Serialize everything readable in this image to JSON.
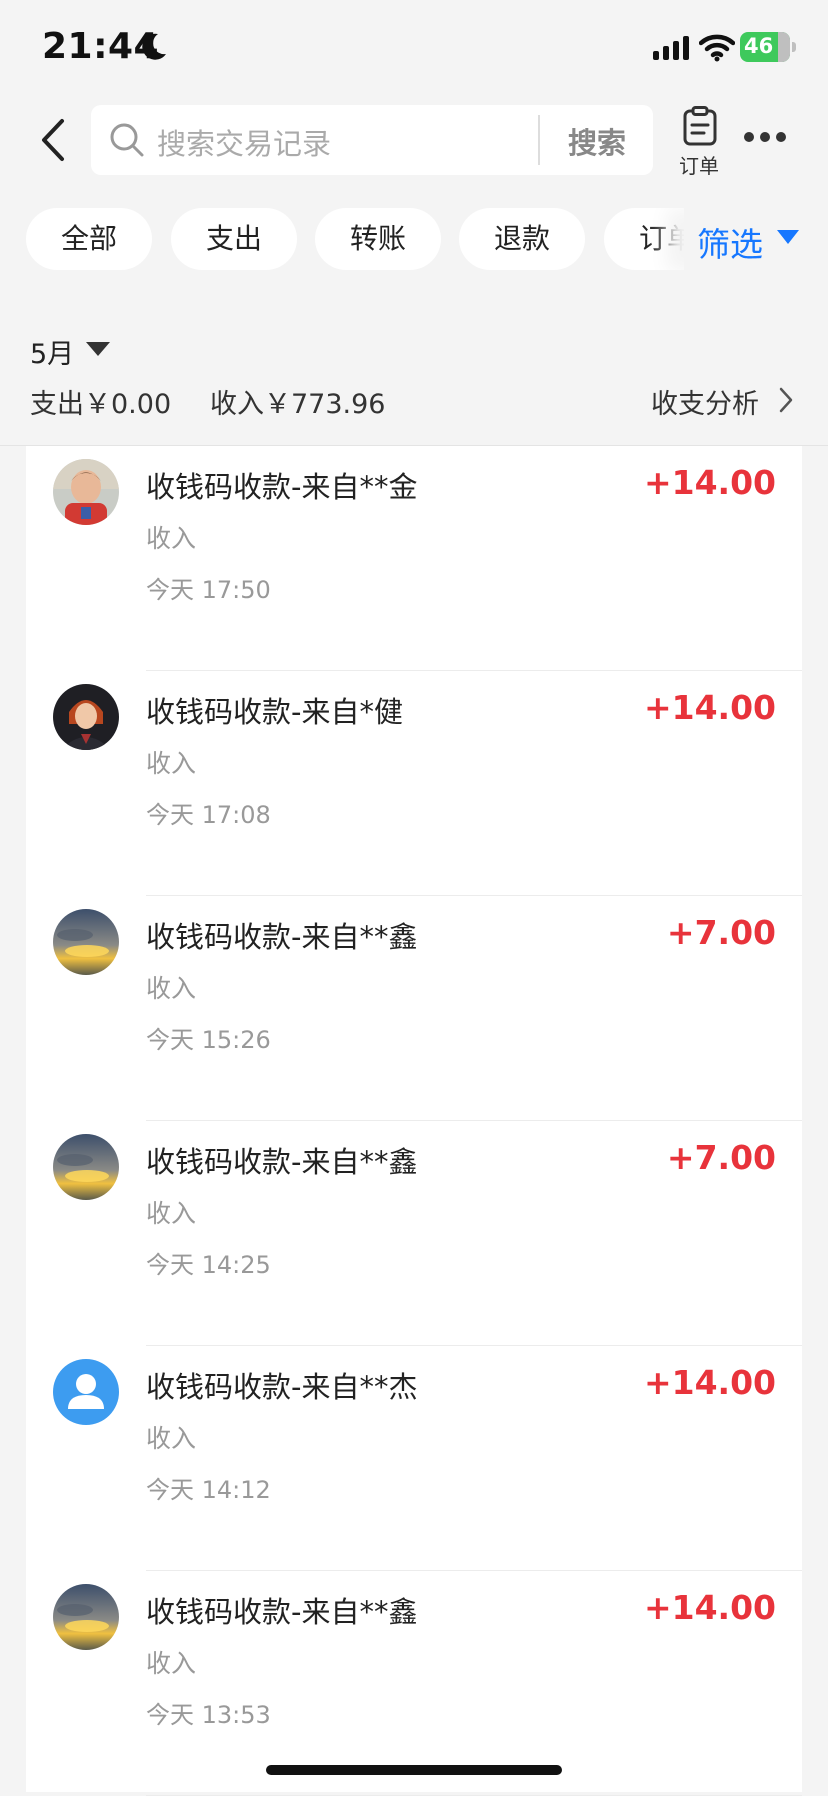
{
  "status": {
    "time": "21:44",
    "battery": "46"
  },
  "header": {
    "search_placeholder": "搜索交易记录",
    "search_button": "搜索",
    "order_label": "订单"
  },
  "filters": {
    "chips": [
      "全部",
      "支出",
      "转账",
      "退款",
      "订单"
    ],
    "filter_label": "筛选"
  },
  "summary": {
    "month": "5月",
    "expense": "支出￥0.00",
    "income": "收入￥773.96",
    "analysis": "收支分析"
  },
  "colors": {
    "accent": "#1677ff",
    "amount": "#e8333b"
  },
  "transactions": [
    {
      "title": "收钱码收款-来自**金",
      "type": "收入",
      "time": "今天 17:50",
      "amount": "+14.00",
      "avatar": "child-photo"
    },
    {
      "title": "收钱码收款-来自*健",
      "type": "收入",
      "time": "今天 17:08",
      "amount": "+14.00",
      "avatar": "character-photo"
    },
    {
      "title": "收钱码收款-来自**鑫",
      "type": "收入",
      "time": "今天 15:26",
      "amount": "+7.00",
      "avatar": "sunset-photo"
    },
    {
      "title": "收钱码收款-来自**鑫",
      "type": "收入",
      "time": "今天 14:25",
      "amount": "+7.00",
      "avatar": "sunset-photo"
    },
    {
      "title": "收钱码收款-来自**杰",
      "type": "收入",
      "time": "今天 14:12",
      "amount": "+14.00",
      "avatar": "default-user-icon"
    },
    {
      "title": "收钱码收款-来自**鑫",
      "type": "收入",
      "time": "今天 13:53",
      "amount": "+14.00",
      "avatar": "sunset-photo"
    }
  ]
}
